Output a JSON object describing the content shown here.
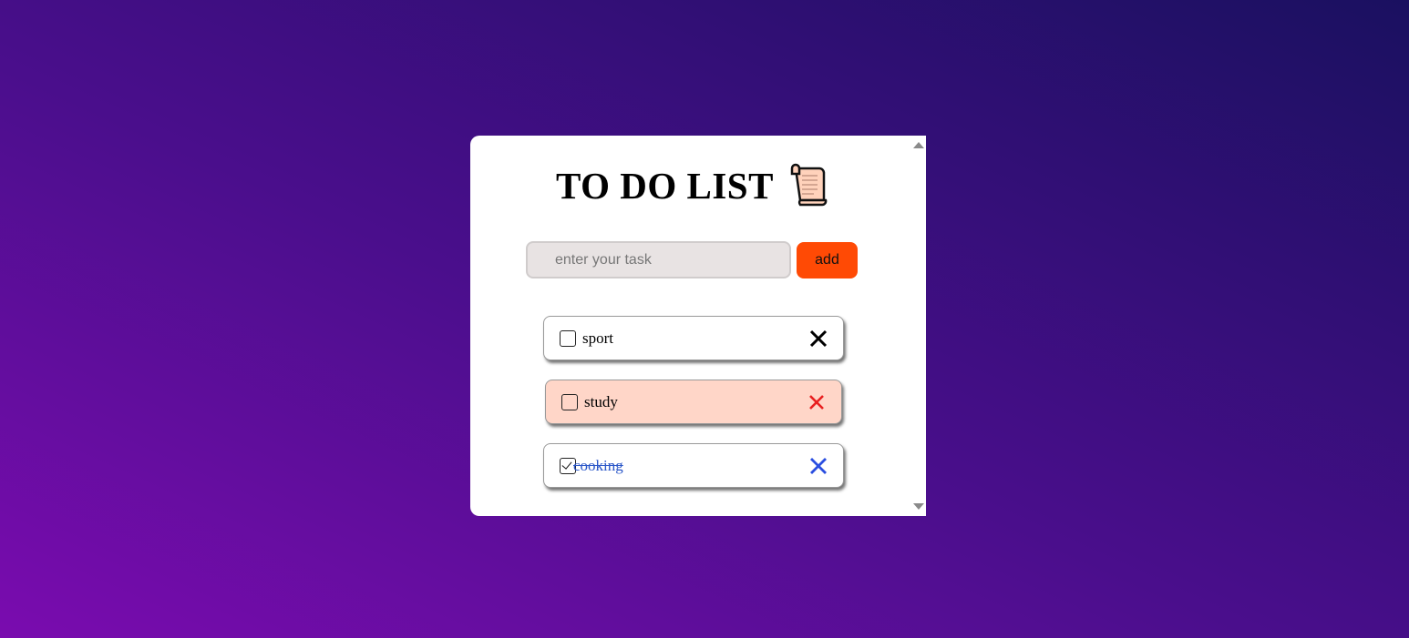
{
  "app": {
    "title": "TO DO LIST",
    "title_icon": "scroll-icon"
  },
  "form": {
    "placeholder": "enter your task",
    "value": "",
    "add_label": "add"
  },
  "tasks": [
    {
      "label": "sport",
      "checked": false,
      "delete_color": "#000000",
      "background": "#ffffff"
    },
    {
      "label": "study",
      "checked": false,
      "delete_color": "#e82020",
      "background": "#ffd6c8"
    },
    {
      "label": "cooking",
      "checked": true,
      "delete_color": "#2a4ee0",
      "background": "#ffffff"
    }
  ],
  "colors": {
    "accent": "#ff4a05",
    "done_text": "#2a56c8"
  }
}
